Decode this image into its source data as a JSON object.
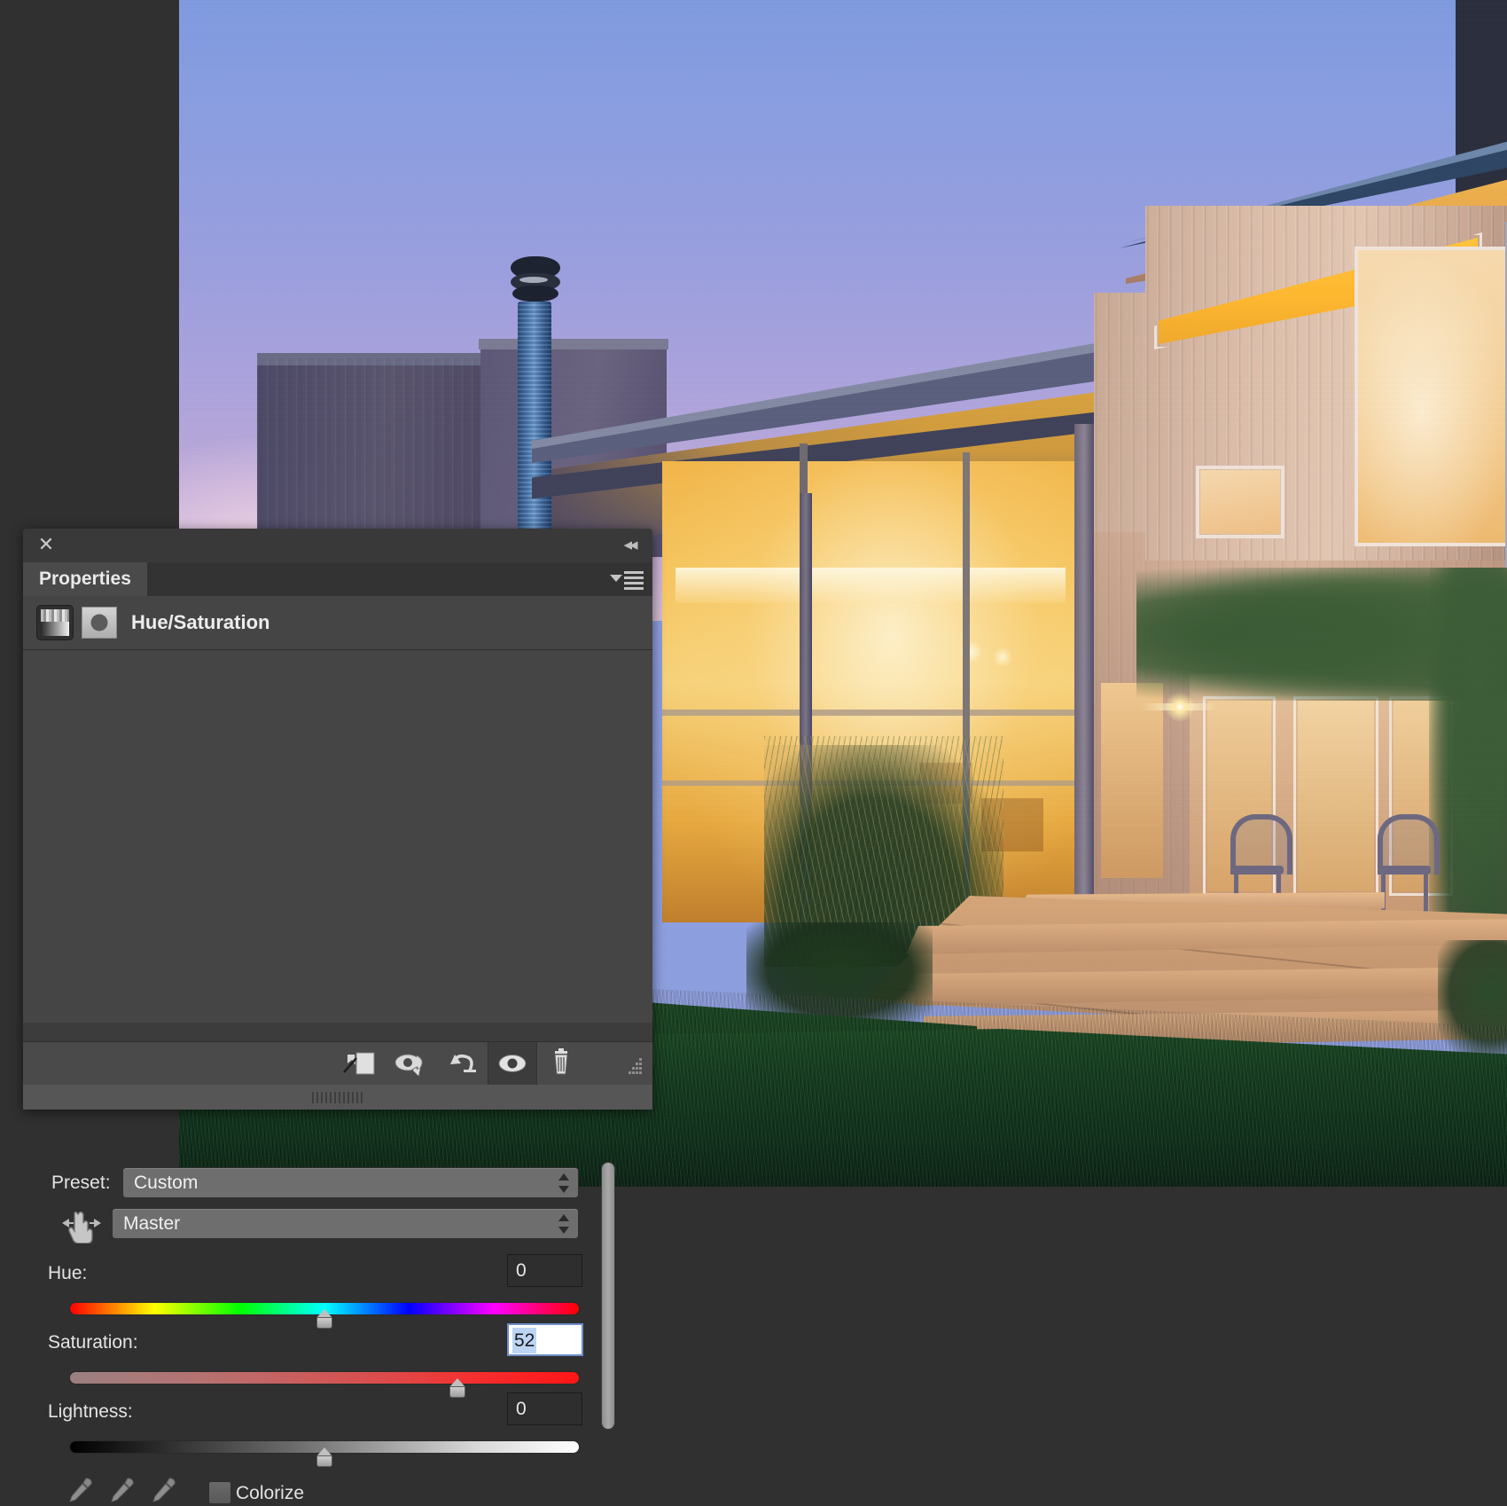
{
  "app": {
    "canvas_background": "#303030",
    "photo_description": "Modern wood-clad house at dusk with warm lit windows, lawn and patio"
  },
  "panel": {
    "title": "Properties",
    "close_icon": "close-icon",
    "collapse_icon": "collapse-to-icons-icon",
    "menu_icon": "panel-menu-icon",
    "adjustment_title": "Hue/Saturation",
    "adjustment_icon": "hue-saturation-adjustment-icon",
    "mask_thumbnail_icon": "layer-mask-thumbnail-icon"
  },
  "controls": {
    "preset_label": "Preset:",
    "preset_value": "Custom",
    "channel_value": "Master",
    "targeted_adjust_icon": "targeted-adjustment-hand-icon",
    "hue_label": "Hue:",
    "hue_value": "0",
    "saturation_label": "Saturation:",
    "saturation_value": "52",
    "lightness_label": "Lightness:",
    "lightness_value": "0",
    "colorize_label": "Colorize",
    "colorize_checked": false,
    "eyedropper_icons": [
      "eyedropper-icon",
      "eyedropper-add-icon",
      "eyedropper-subtract-icon"
    ]
  },
  "slider_positions": {
    "hue_percent": 50,
    "saturation_percent": 76,
    "lightness_percent": 50
  },
  "footer": {
    "clip_to_layer_icon": "clip-to-layer-icon",
    "previous_state_icon": "view-previous-state-icon",
    "reset_icon": "reset-adjustment-icon",
    "visibility_icon": "toggle-layer-visibility-icon",
    "delete_icon": "delete-adjustment-layer-icon",
    "resize_grip_icon": "resize-grip-icon"
  },
  "colors": {
    "panel_bg": "#454545",
    "panel_header_bg": "#393939",
    "tab_active_bg": "#4a4a4a",
    "canvas_bg": "#303030",
    "input_selection": "#bcd5f5",
    "input_focus_border": "#6d8ec7"
  }
}
